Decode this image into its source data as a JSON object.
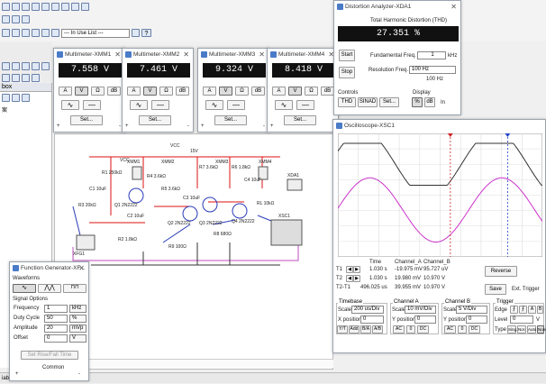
{
  "app": {
    "toolbar": {
      "in_use_list": "--- In Use List ---",
      "help": "?"
    },
    "panel_header": "box",
    "panel_text": "案",
    "status": "iable"
  },
  "multimeters": [
    {
      "title": "Multimeter-XMM1",
      "value": "7.558 V",
      "buttons": [
        "A",
        "V",
        "Ω",
        "dB"
      ],
      "set_label": "Set...",
      "terminals": [
        "+",
        "-"
      ]
    },
    {
      "title": "Multimeter-XMM2",
      "value": "7.461 V",
      "buttons": [
        "A",
        "V",
        "Ω",
        "dB"
      ],
      "set_label": "Set...",
      "terminals": [
        "+",
        "-"
      ]
    },
    {
      "title": "Multimeter-XMM3",
      "value": "9.324 V",
      "buttons": [
        "A",
        "V",
        "Ω",
        "dB"
      ],
      "set_label": "Set...",
      "terminals": [
        "+",
        "-"
      ]
    },
    {
      "title": "Multimeter-XMM4",
      "value": "8.418 V",
      "buttons": [
        "A",
        "V",
        "Ω",
        "dB"
      ],
      "set_label": "Set...",
      "terminals": [
        "+",
        "-"
      ]
    }
  ],
  "distortion": {
    "title": "Distortion Analyzer-XDA1",
    "header": "Total Harmonic Distortion (THD)",
    "value": "27.351 %",
    "start": "Start",
    "stop": "Stop",
    "fund_freq_label": "Fundamental Freq.",
    "fund_freq_value": "1",
    "fund_freq_unit": "kHz",
    "res_freq_label": "Resolution Freq.",
    "res_freq_value": "100 Hz",
    "res_freq_note": "100 Hz",
    "controls_label": "Controls",
    "display_label": "Display",
    "thd": "THD",
    "sinad": "SINAD",
    "set": "Set...",
    "percent": "%",
    "db": "dB",
    "in": "In"
  },
  "oscilloscope": {
    "title": "Oscilloscope-XSC1",
    "readout": {
      "headers": [
        "Time",
        "Channel_A",
        "Channel_B"
      ],
      "rows": [
        {
          "label": "T1",
          "time": "1.030 s",
          "a": "-19.975 mV",
          "b": "95.727 uV"
        },
        {
          "label": "T2",
          "time": "1.030 s",
          "a": "19.980 mV",
          "b": "10.970 V"
        },
        {
          "label": "T2-T1",
          "time": "496.025 us",
          "a": "39.955 mV",
          "b": "10.970 V"
        }
      ]
    },
    "reverse": "Reverse",
    "save": "Save",
    "ext_trigger": "Ext. Trigger",
    "timebase": {
      "label": "Timebase",
      "scale_label": "Scale",
      "scale": "200 us/Div",
      "pos_label": "X position",
      "pos": "0",
      "modes": [
        "Y/T",
        "Add",
        "B/A",
        "A/B"
      ]
    },
    "channel_a": {
      "label": "Channel A",
      "scale_label": "Scale",
      "scale": "10 mV/Div",
      "pos_label": "Y position",
      "pos": "0",
      "coupling": [
        "AC",
        "0",
        "DC"
      ]
    },
    "channel_b": {
      "label": "Channel B",
      "scale_label": "Scale",
      "scale": "5 V/Div",
      "pos_label": "Y position",
      "pos": "0",
      "coupling": [
        "AC",
        "0",
        "DC"
      ]
    },
    "trigger": {
      "label": "Trigger",
      "edge_label": "Edge",
      "level_label": "Level",
      "level": "0",
      "level_unit": "V",
      "type_label": "Type",
      "types": [
        "Sing.",
        "Nor.",
        "Auto",
        "None"
      ]
    },
    "colors": {
      "channel_a": "#333333",
      "channel_b": "#cc33cc",
      "cursor_1": "#cc2222",
      "cursor_2": "#2244cc"
    }
  },
  "function_generator": {
    "title": "Function Generator-XF...",
    "waveforms_label": "Waveforms",
    "signal_options_label": "Signal Options",
    "rows": [
      {
        "label": "Frequency",
        "value": "1",
        "unit": "kHz"
      },
      {
        "label": "Duty Cycle",
        "value": "50",
        "unit": "%"
      },
      {
        "label": "Amplitude",
        "value": "20",
        "unit": "mVp"
      },
      {
        "label": "Offset",
        "value": "0",
        "unit": "V"
      }
    ],
    "set_rise": "Set Rise/Fall Time",
    "common": "Common",
    "terminals": [
      "+",
      "-"
    ]
  },
  "circuit": {
    "vcc": "VCC",
    "vcc_value": "15V",
    "vcc_left": "VCC",
    "labels": [
      "R1 250kΩ",
      "R4 3.6kΩ",
      "R5 3.6kΩ",
      "R7 3.6kΩ",
      "R6 1.8kΩ",
      "R8 680Ω",
      "C1 10uF",
      "C2 10uF",
      "C3 10uF",
      "C4 10uF",
      "R2 1.8kΩ",
      "R3 20kΩ",
      "R9 100Ω",
      "Q1 2N2222",
      "Q2 2N2222",
      "Q3 2N2222",
      "Q4 2N2222",
      "XFG1",
      "XMM1",
      "XMM2",
      "XMM3",
      "XMM4",
      "XDA1",
      "XSC1",
      "RL 10kΩ"
    ]
  }
}
